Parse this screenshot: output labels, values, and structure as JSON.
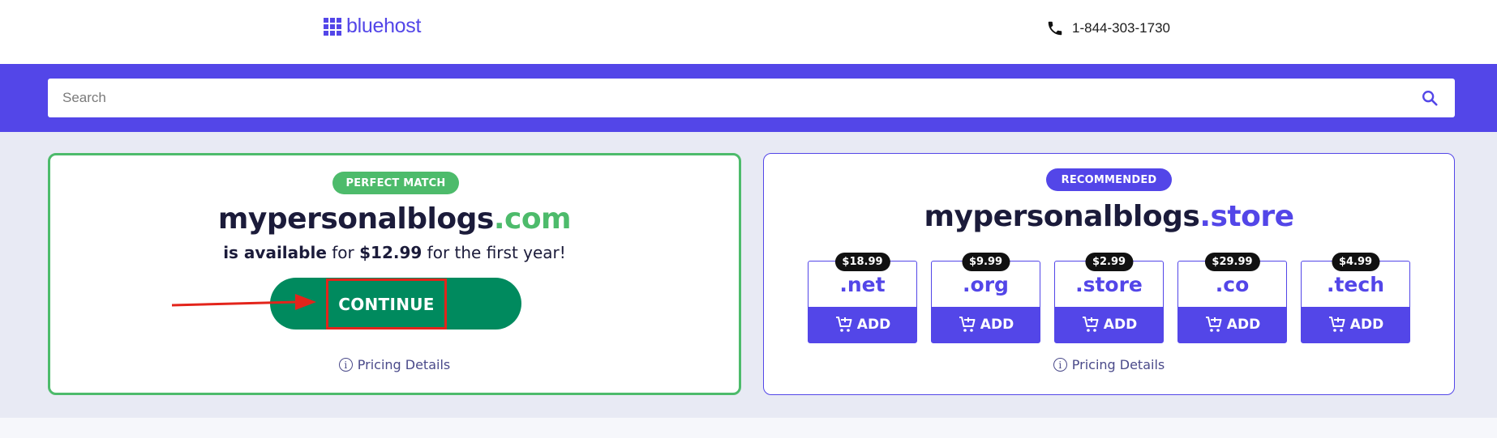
{
  "header": {
    "logo_text": "bluehost",
    "phone": "1-844-303-1730"
  },
  "search": {
    "placeholder": "Search",
    "value": ""
  },
  "primary_result": {
    "badge": "PERFECT MATCH",
    "domain_name": "mypersonalblogs",
    "domain_tld": ".com",
    "availability_bold": "is available",
    "availability_for": "for",
    "price": "$12.99",
    "price_suffix": "for the first year!",
    "continue_label": "CONTINUE",
    "pricing_details": "Pricing Details"
  },
  "recommended": {
    "badge": "RECOMMENDED",
    "domain_name": "mypersonalblogs",
    "domain_tld": ".store",
    "pricing_details": "Pricing Details",
    "tlds": [
      {
        "price": "$18.99",
        "tld": ".net",
        "add_label": "ADD"
      },
      {
        "price": "$9.99",
        "tld": ".org",
        "add_label": "ADD"
      },
      {
        "price": "$2.99",
        "tld": ".store",
        "add_label": "ADD"
      },
      {
        "price": "$29.99",
        "tld": ".co",
        "add_label": "ADD"
      },
      {
        "price": "$4.99",
        "tld": ".tech",
        "add_label": "ADD"
      }
    ]
  },
  "colors": {
    "brand": "#5346e8",
    "match_green": "#4dbb6b",
    "continue_green": "#008a5e",
    "highlight_red": "#e3241b"
  }
}
